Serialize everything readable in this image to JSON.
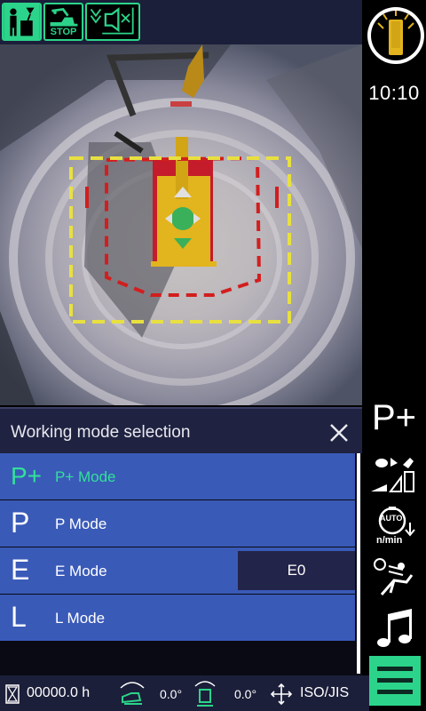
{
  "status": {
    "icons": [
      "operator-seat-icon",
      "machine-stop-icon",
      "voice-warning-icon"
    ],
    "stop_label": "STOP"
  },
  "right_rail": {
    "time": "10:10",
    "current_mode": "P+",
    "auto_idle_unit": "n/min",
    "auto_label": "AUTO"
  },
  "panel": {
    "title": "Working mode selection",
    "modes": [
      {
        "letter": "P+",
        "name": "P+ Mode",
        "selected": true
      },
      {
        "letter": "P",
        "name": "P Mode",
        "selected": false
      },
      {
        "letter": "E",
        "name": "E Mode",
        "selected": false,
        "sub": "E0"
      },
      {
        "letter": "L",
        "name": "L Mode",
        "selected": false
      }
    ]
  },
  "bottom": {
    "hour_meter": "00000.0 h",
    "pitch_angle": "0.0°",
    "roll_angle": "0.0°",
    "control_pattern": "ISO/JIS"
  },
  "colors": {
    "accent": "#2bd48a",
    "row_blue": "#3a5ab8",
    "selected_text": "#33e09a",
    "header_bg": "#1f2240"
  }
}
